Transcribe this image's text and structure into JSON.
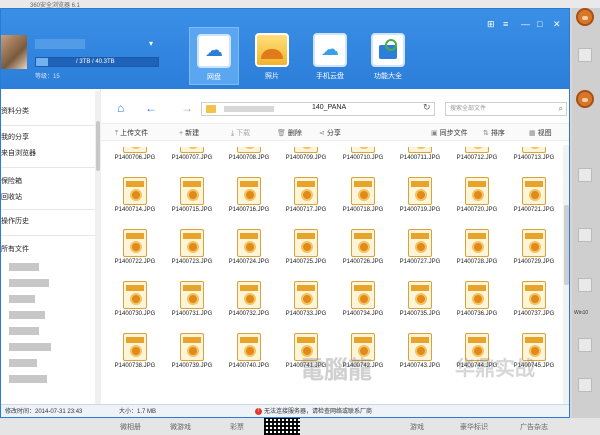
{
  "app": {
    "title": "360安全浏览器 6.1"
  },
  "user": {
    "quota": "/ 3TB / 40.3TB",
    "level": "等级：15"
  },
  "nav": [
    {
      "label": "网盘",
      "icon": "cloud-disk-icon"
    },
    {
      "label": "照片",
      "icon": "photo-icon"
    },
    {
      "label": "手机云盘",
      "icon": "phone-cloud-icon"
    },
    {
      "label": "功能大全",
      "icon": "toolbox-icon"
    }
  ],
  "sidebar": {
    "items": [
      {
        "label": "资料分类"
      },
      {
        "label": "我的分享"
      },
      {
        "label": "来自浏览器"
      },
      {
        "label": "保险箱"
      },
      {
        "label": "回收站"
      },
      {
        "label": "操作历史"
      },
      {
        "label": "所有文件"
      }
    ]
  },
  "address": {
    "crumb": "140_PANA",
    "search_placeholder": "搜索全部文件"
  },
  "toolbar": {
    "upload": "上传文件",
    "new": "新建",
    "download": "下载",
    "delete": "删除",
    "share": "分享",
    "sync": "同步文件",
    "sort": "排序",
    "view": "视图"
  },
  "files": [
    "P1400706.JPG",
    "P1400707.JPG",
    "P1400708.JPG",
    "P1400709.JPG",
    "P1400710.JPG",
    "P1400711.JPG",
    "P1400712.JPG",
    "P1400713.JPG",
    "P1400714.JPG",
    "P1400715.JPG",
    "P1400716.JPG",
    "P1400717.JPG",
    "P1400718.JPG",
    "P1400719.JPG",
    "P1400720.JPG",
    "P1400721.JPG",
    "P1400722.JPG",
    "P1400723.JPG",
    "P1400724.JPG",
    "P1400725.JPG",
    "P1400726.JPG",
    "P1400727.JPG",
    "P1400728.JPG",
    "P1400729.JPG",
    "P1400730.JPG",
    "P1400731.JPG",
    "P1400732.JPG",
    "P1400733.JPG",
    "P1400734.JPG",
    "P1400735.JPG",
    "P1400736.JPG",
    "P1400737.JPG",
    "P1400738.JPG",
    "P1400739.JPG",
    "P1400740.JPG",
    "P1400741.JPG",
    "P1400742.JPG",
    "P1400743.JPG",
    "P1400744.JPG",
    "P1400745.JPG"
  ],
  "status": {
    "date": "修改时间：2014-07-31 23:43",
    "size": "大小：1.7 MB",
    "error": "无法连接服务器，请检查网络或联系厂商"
  },
  "footer": {
    "links": [
      "微相册",
      "微游戏",
      "彩票",
      "游戏",
      "豪华标识",
      "广告杂志"
    ]
  },
  "desktop": {
    "label": "Win10"
  },
  "watermark": {
    "text1": "電腦龍",
    "text2": "华鼎实战"
  }
}
